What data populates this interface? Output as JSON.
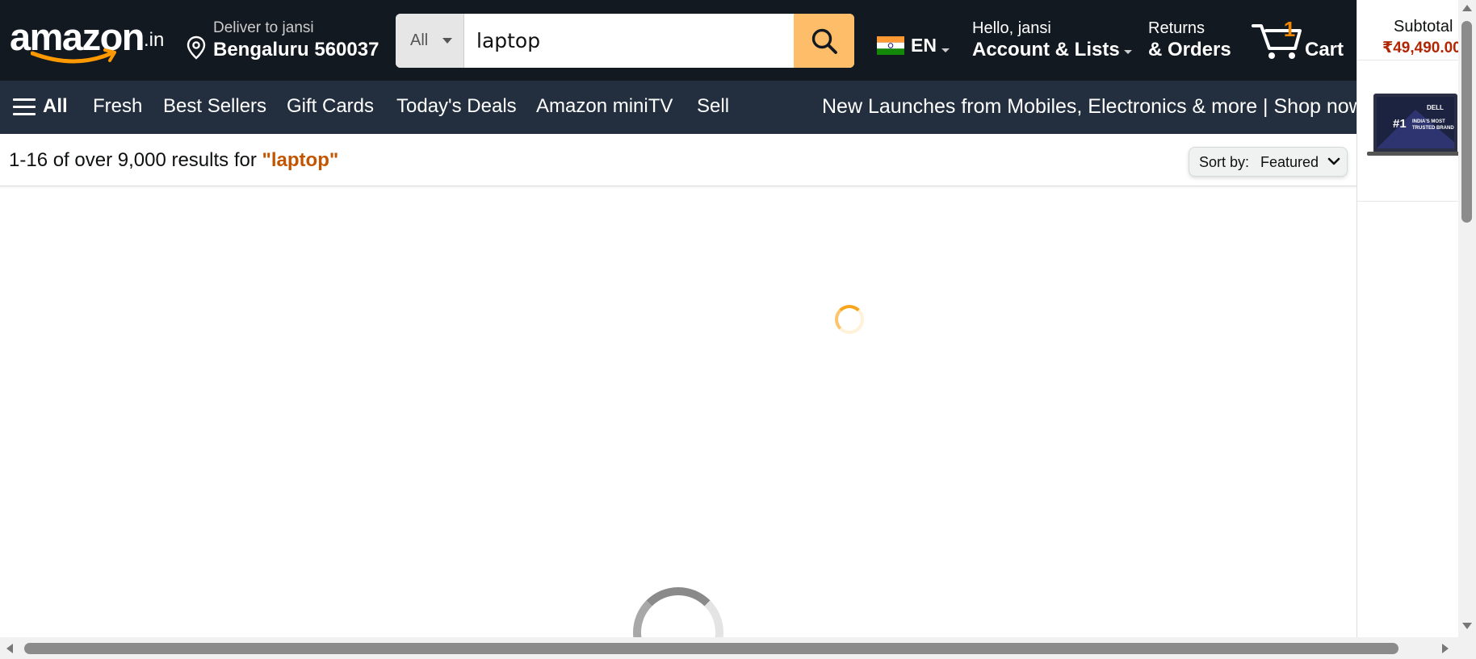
{
  "header": {
    "logo_text": "amazon",
    "logo_tld": ".in",
    "deliver": {
      "line1": "Deliver to jansi",
      "line2": "Bengaluru 560037"
    },
    "search": {
      "category": "All",
      "query": "laptop"
    },
    "language": "EN",
    "account": {
      "line1": "Hello, jansi",
      "line2": "Account & Lists"
    },
    "returns": {
      "line1": "Returns",
      "line2": "& Orders"
    },
    "cart": {
      "count": "1",
      "label": "Cart"
    }
  },
  "subnav": {
    "all": "All",
    "items": [
      "Fresh",
      "Best Sellers",
      "Gift Cards",
      "Today's Deals",
      "Amazon miniTV",
      "Sell"
    ],
    "promo": "New Launches from Mobiles, Electronics & more | Shop now"
  },
  "results": {
    "summary": "1-16 of over 9,000 results for ",
    "query": "\"laptop\"",
    "sort_label": "Sort by:",
    "sort_value": "Featured"
  },
  "side_cart": {
    "subtotal_label": "Subtotal",
    "subtotal_value": "₹49,490.00",
    "item_image_text": "DELL #1 INDIA'S MOST TRUSTED BRAND"
  },
  "icons": {
    "location": "location-pin-icon",
    "search": "search-icon",
    "flag": "india-flag-icon",
    "cart": "cart-icon",
    "menu": "hamburger-menu-icon",
    "sort_caret": "chevron-down-icon"
  },
  "colors": {
    "nav_dark": "#131921",
    "nav_secondary": "#232f3e",
    "search_button": "#febd69",
    "cart_count": "#f08804",
    "query_highlight": "#c45500",
    "price": "#b12704"
  }
}
